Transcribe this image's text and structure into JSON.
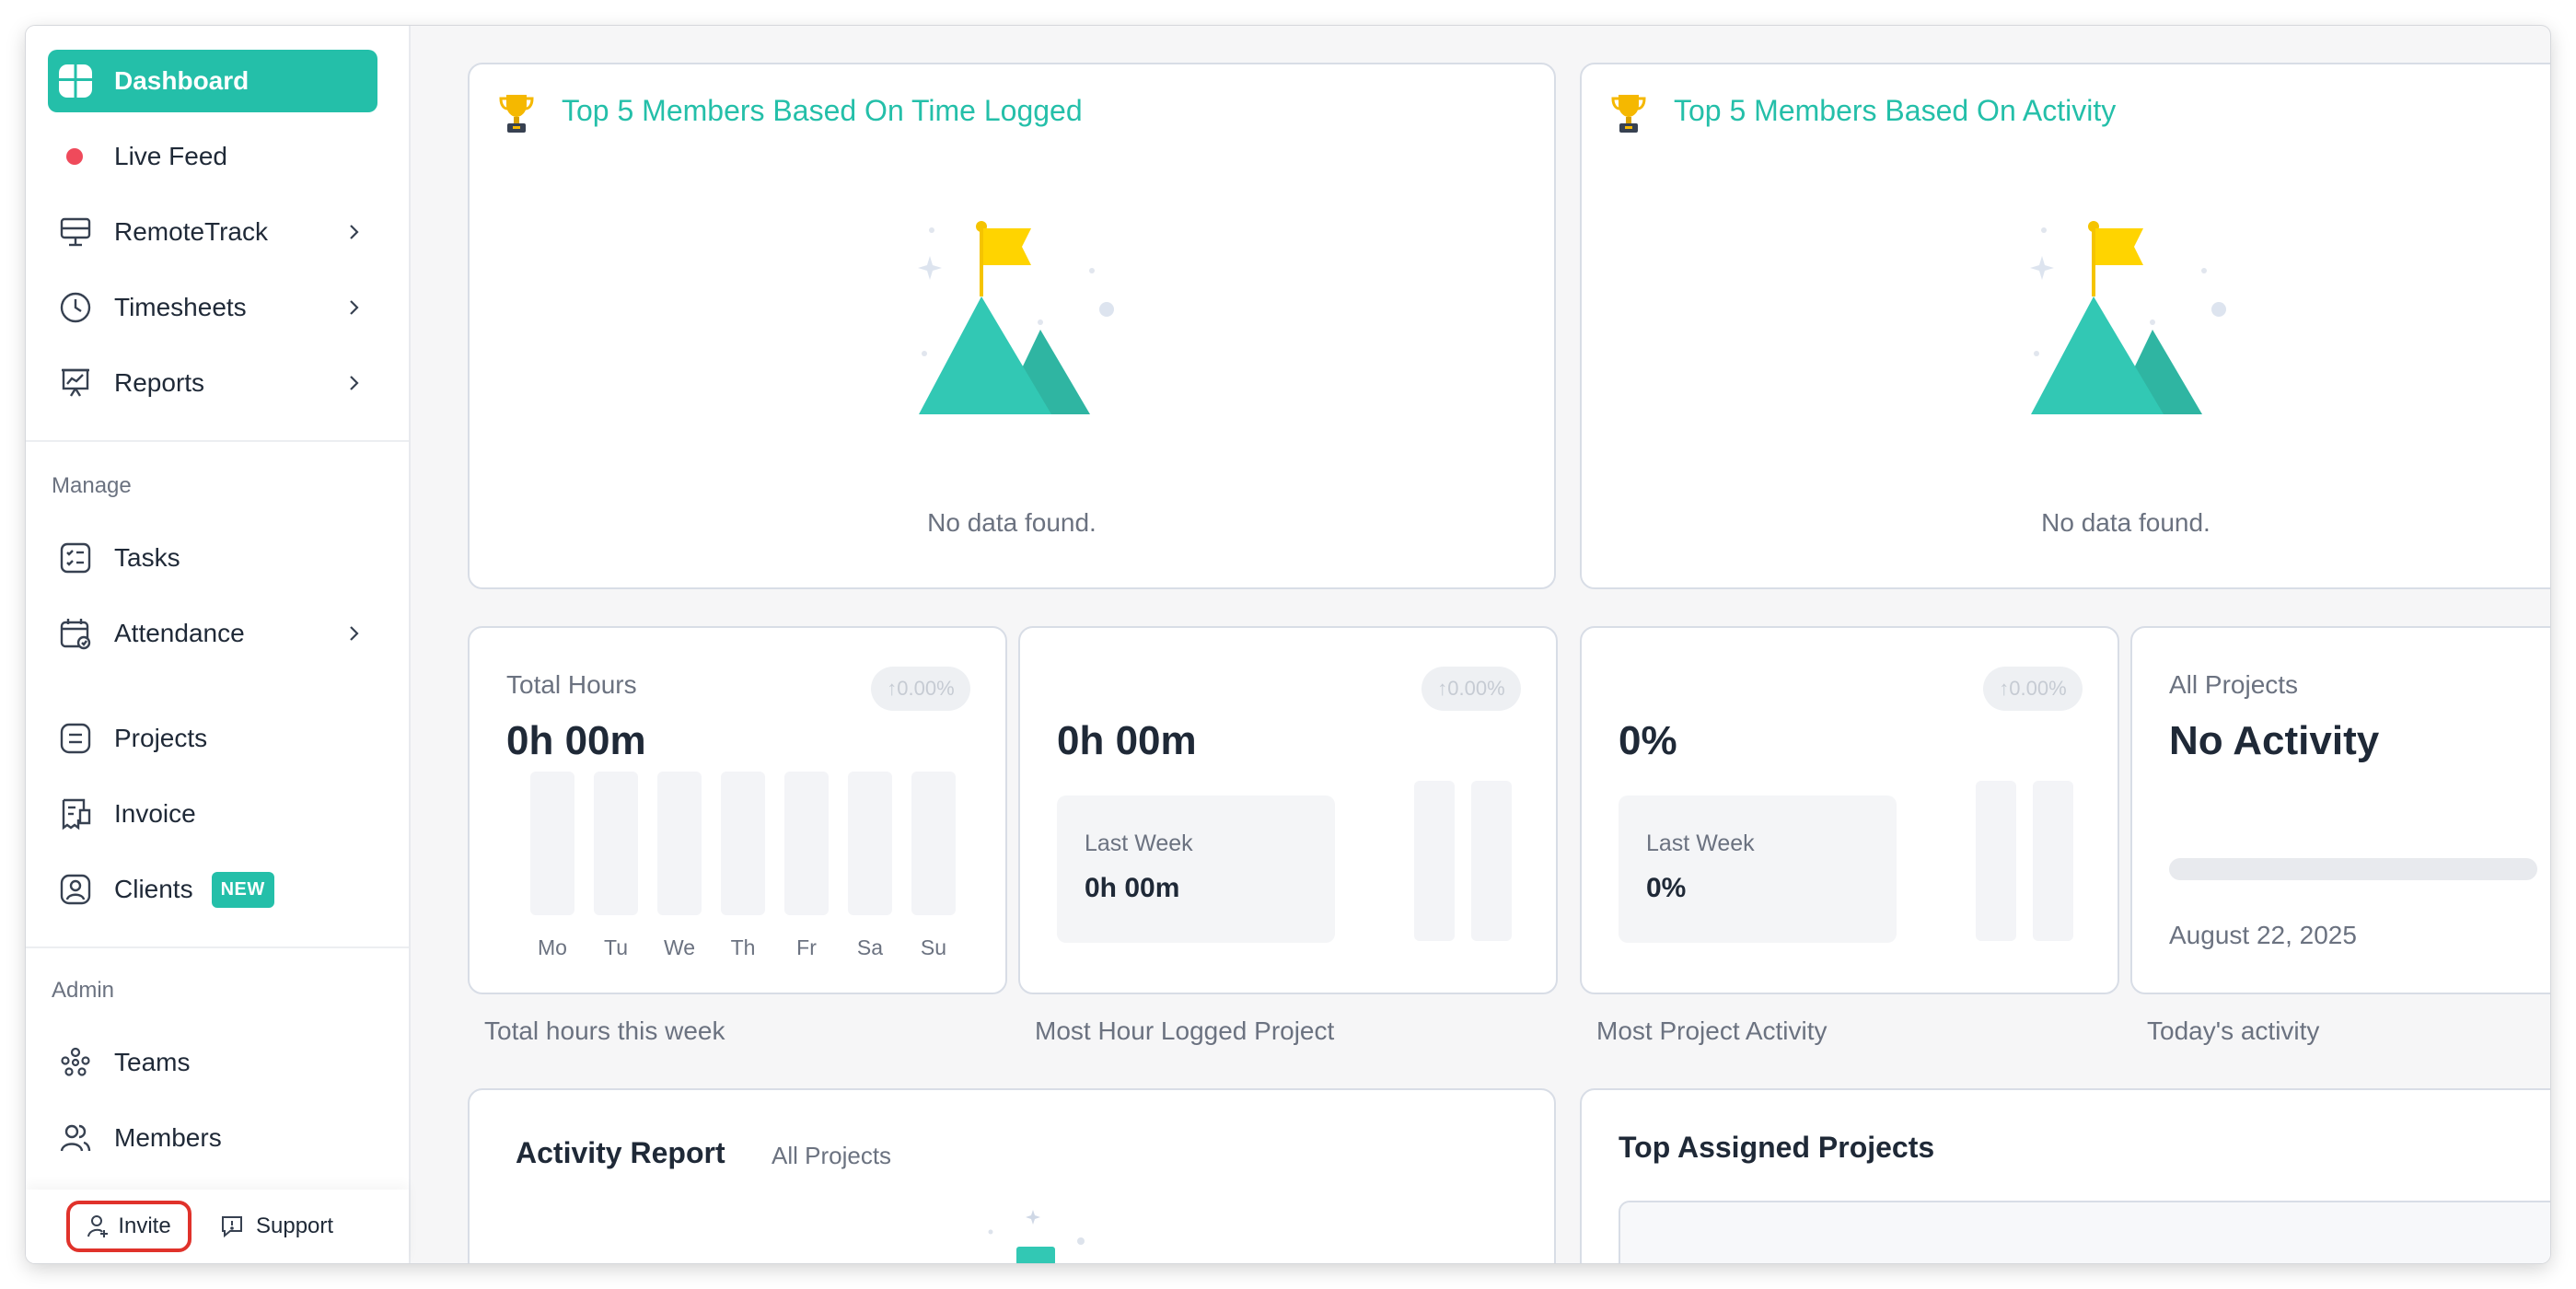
{
  "sidebar": {
    "nav": {
      "dashboard": "Dashboard",
      "live_feed": "Live Feed",
      "remotetrack": "RemoteTrack",
      "timesheets": "Timesheets",
      "reports": "Reports"
    },
    "manage_label": "Manage",
    "manage": {
      "tasks": "Tasks",
      "attendance": "Attendance",
      "projects": "Projects",
      "invoice": "Invoice",
      "clients": "Clients",
      "clients_badge": "NEW"
    },
    "admin_label": "Admin",
    "admin": {
      "teams": "Teams",
      "members": "Members"
    },
    "footer": {
      "invite": "Invite",
      "support": "Support"
    }
  },
  "top_cards": {
    "time_logged": {
      "title": "Top 5 Members Based On Time Logged",
      "empty": "No data found."
    },
    "activity": {
      "title": "Top 5 Members Based On Activity",
      "empty": "No data found."
    }
  },
  "stats": {
    "total_hours": {
      "label": "Total Hours",
      "value": "0h 00m",
      "trend": "↑0.00%",
      "days": [
        "Mo",
        "Tu",
        "We",
        "Th",
        "Fr",
        "Sa",
        "Su"
      ],
      "caption": "Total hours this week"
    },
    "most_hour_project": {
      "value": "0h 00m",
      "trend": "↑0.00%",
      "last_week_label": "Last Week",
      "last_week_value": "0h 00m",
      "caption": "Most Hour Logged Project"
    },
    "most_activity": {
      "value": "0%",
      "trend": "↑0.00%",
      "last_week_label": "Last Week",
      "last_week_value": "0%",
      "caption": "Most Project Activity"
    },
    "todays_activity": {
      "label": "All Projects",
      "value": "No Activity",
      "date": "August 22, 2025",
      "caption": "Today's activity"
    }
  },
  "bottom": {
    "activity_report": {
      "title": "Activity Report",
      "filter": "All Projects"
    },
    "top_assigned": {
      "title": "Top Assigned Projects"
    }
  },
  "colors": {
    "accent": "#24bfa9",
    "live_dot": "#ef4a5b",
    "invite_highlight": "#e0322b"
  }
}
